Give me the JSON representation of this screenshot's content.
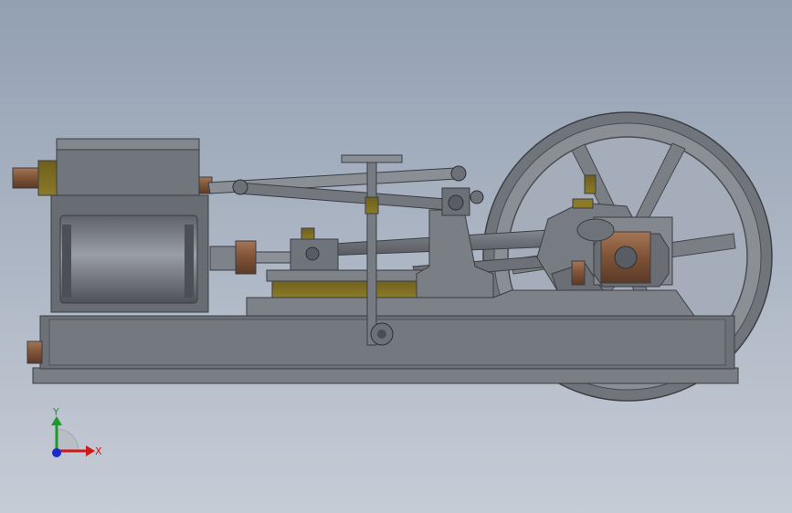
{
  "viewport": {
    "background_top": "#93a0b2",
    "background_bottom": "#c6ccd6"
  },
  "model": {
    "icon": "horizontal-steam-engine-assembly",
    "colors": {
      "steel": "#7d8188",
      "dark_steel": "#54575d",
      "brass": "#8a7a2a",
      "copper": "#8a5a3c"
    }
  },
  "triad": {
    "y_label": "Y",
    "x_label": "X",
    "y_color": "#1a9a2a",
    "x_color": "#d01818",
    "z_color": "#1a2ad0"
  }
}
